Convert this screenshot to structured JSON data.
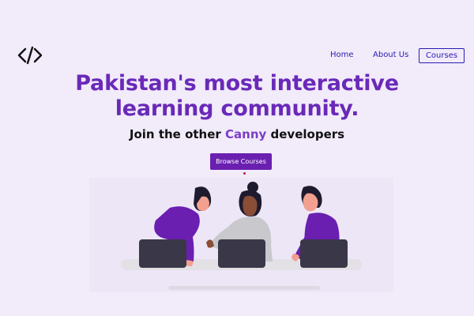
{
  "header": {
    "logo_icon": "code-brackets-icon"
  },
  "nav": {
    "home": "Home",
    "about": "About Us",
    "courses": "Courses"
  },
  "hero": {
    "headline_line1": "Pakistan's most interactive",
    "headline_line2": "learning community.",
    "sub_prefix": "Join the other ",
    "sub_brand": "Canny",
    "sub_suffix": " developers",
    "cta_label": "Browse Courses"
  },
  "colors": {
    "background": "#f1ebfa",
    "accent": "#6a29b8",
    "nav_link": "#2a1cb0",
    "button": "#6a1fb0"
  },
  "illustration": {
    "icon": "team-working-laptops-illustration"
  }
}
